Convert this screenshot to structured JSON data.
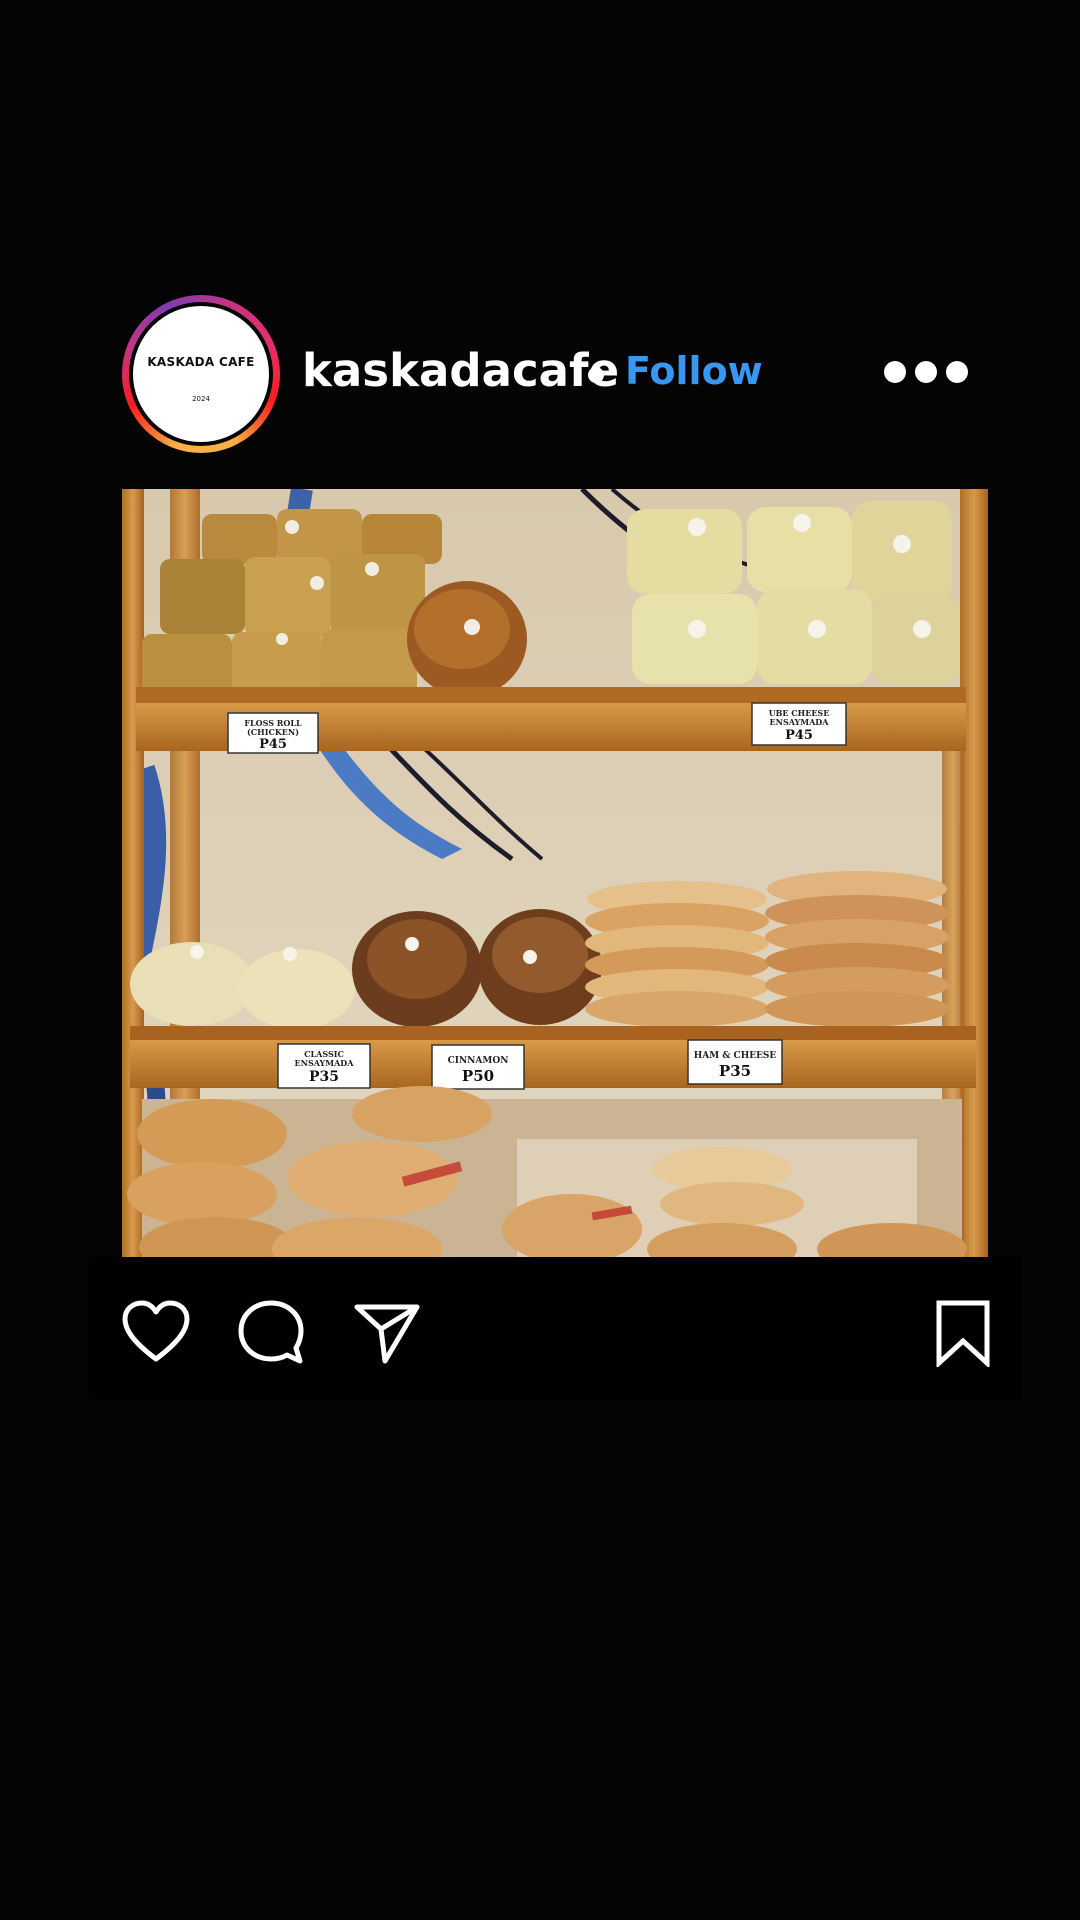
{
  "post": {
    "account": {
      "username": "kaskadacafe",
      "avatar_text": "KASKADA CAFE",
      "avatar_year": "2024",
      "follow_label": "Follow"
    },
    "photo": {
      "price_tags": [
        {
          "line1": "FLOSS ROLL",
          "line2": "(CHICKEN)",
          "price": "P45"
        },
        {
          "line1": "UBE CHEESE",
          "line2": "ENSAYMADA",
          "price": "P45"
        },
        {
          "line1": "CLASSIC",
          "line2": "ENSAYMADA",
          "price": "P35"
        },
        {
          "line1": "CINNAMON",
          "line2": "",
          "price": "P50"
        },
        {
          "line1": "HAM & CHEESE",
          "line2": "",
          "price": "P35"
        }
      ]
    },
    "actions": {
      "icons": [
        "heart-icon",
        "comment-icon",
        "share-icon",
        "bookmark-icon"
      ]
    }
  },
  "colors": {
    "background": "#040404",
    "follow": "#3897f0",
    "text": "#ffffff",
    "wood": "#c07a2c"
  }
}
